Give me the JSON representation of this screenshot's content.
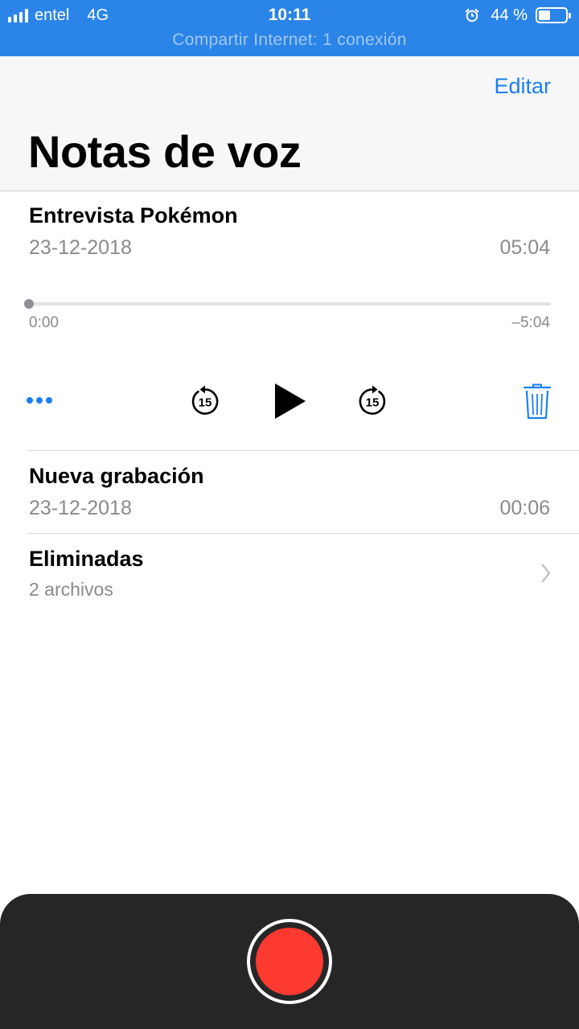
{
  "status_bar": {
    "carrier": "entel",
    "network": "4G",
    "time": "10:11",
    "battery_percent": "44 %",
    "battery_level": 0.44,
    "hotspot_text": "Compartir Internet: 1 conexión",
    "icons": [
      "signal-icon",
      "alarm-icon",
      "battery-icon"
    ]
  },
  "header": {
    "edit_label": "Editar",
    "title": "Notas de voz"
  },
  "recordings": [
    {
      "title": "Entrevista Pokémon",
      "date": "23-12-2018",
      "duration": "05:04",
      "expanded": true,
      "player": {
        "elapsed": "0:00",
        "remaining": "–5:04",
        "progress": 0.0,
        "skip_back_seconds": "15",
        "skip_forward_seconds": "15",
        "icons": [
          "more-icon",
          "skip-back-15-icon",
          "play-icon",
          "skip-forward-15-icon",
          "trash-icon"
        ]
      }
    },
    {
      "title": "Nueva grabación",
      "date": "23-12-2018",
      "duration": "00:06",
      "expanded": false
    }
  ],
  "deleted_folder": {
    "title": "Eliminadas",
    "subtitle": "2 archivos",
    "icon": "chevron-right-icon"
  },
  "record_panel": {
    "icon": "record-icon"
  },
  "colors": {
    "status_bar_bg": "#2b84e8",
    "accent_blue": "#1a7ff4",
    "record_red": "#fc3a30",
    "panel_bg": "#262626",
    "secondary_text": "#8a8a8e"
  }
}
